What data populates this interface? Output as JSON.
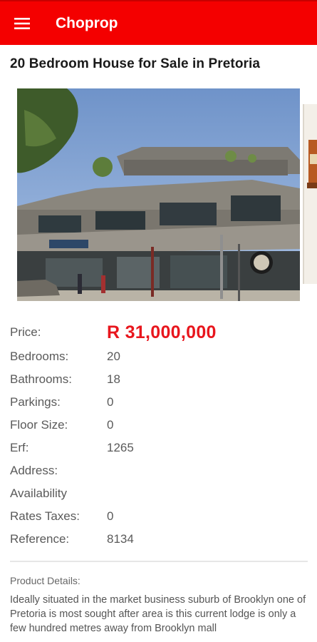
{
  "app_bar": {
    "title": "Choprop",
    "menu_icon": "hamburger-menu-icon",
    "background_color": "#f40000"
  },
  "listing": {
    "title": "20 Bedroom House for Sale in Pretoria",
    "photos": [
      {
        "alt": "street-view-commercial-building-photo"
      },
      {
        "alt": "next-property-photo"
      }
    ]
  },
  "specs": {
    "price": {
      "label": "Price:",
      "value": "R 31,000,000"
    },
    "bedrooms": {
      "label": "Bedrooms:",
      "value": "20"
    },
    "bathrooms": {
      "label": "Bathrooms:",
      "value": "18"
    },
    "parkings": {
      "label": "Parkings:",
      "value": "0"
    },
    "floor_size": {
      "label": "Floor Size:",
      "value": "0"
    },
    "erf": {
      "label": "Erf:",
      "value": "1265"
    },
    "address": {
      "label": "Address:",
      "value": ""
    },
    "availability": {
      "label": "Availability",
      "value": ""
    },
    "rates_taxes": {
      "label": "Rates Taxes:",
      "value": "0"
    },
    "reference": {
      "label": "Reference:",
      "value": "8134"
    }
  },
  "product_details": {
    "heading": "Product Details:",
    "text": "Ideally situated in the market business suburb of Brooklyn one of Pretoria is most sought after area is this current lodge is only a few hundred metres away from Brooklyn mall"
  },
  "colors": {
    "price": "#e8161d",
    "accent": "#f40000"
  }
}
